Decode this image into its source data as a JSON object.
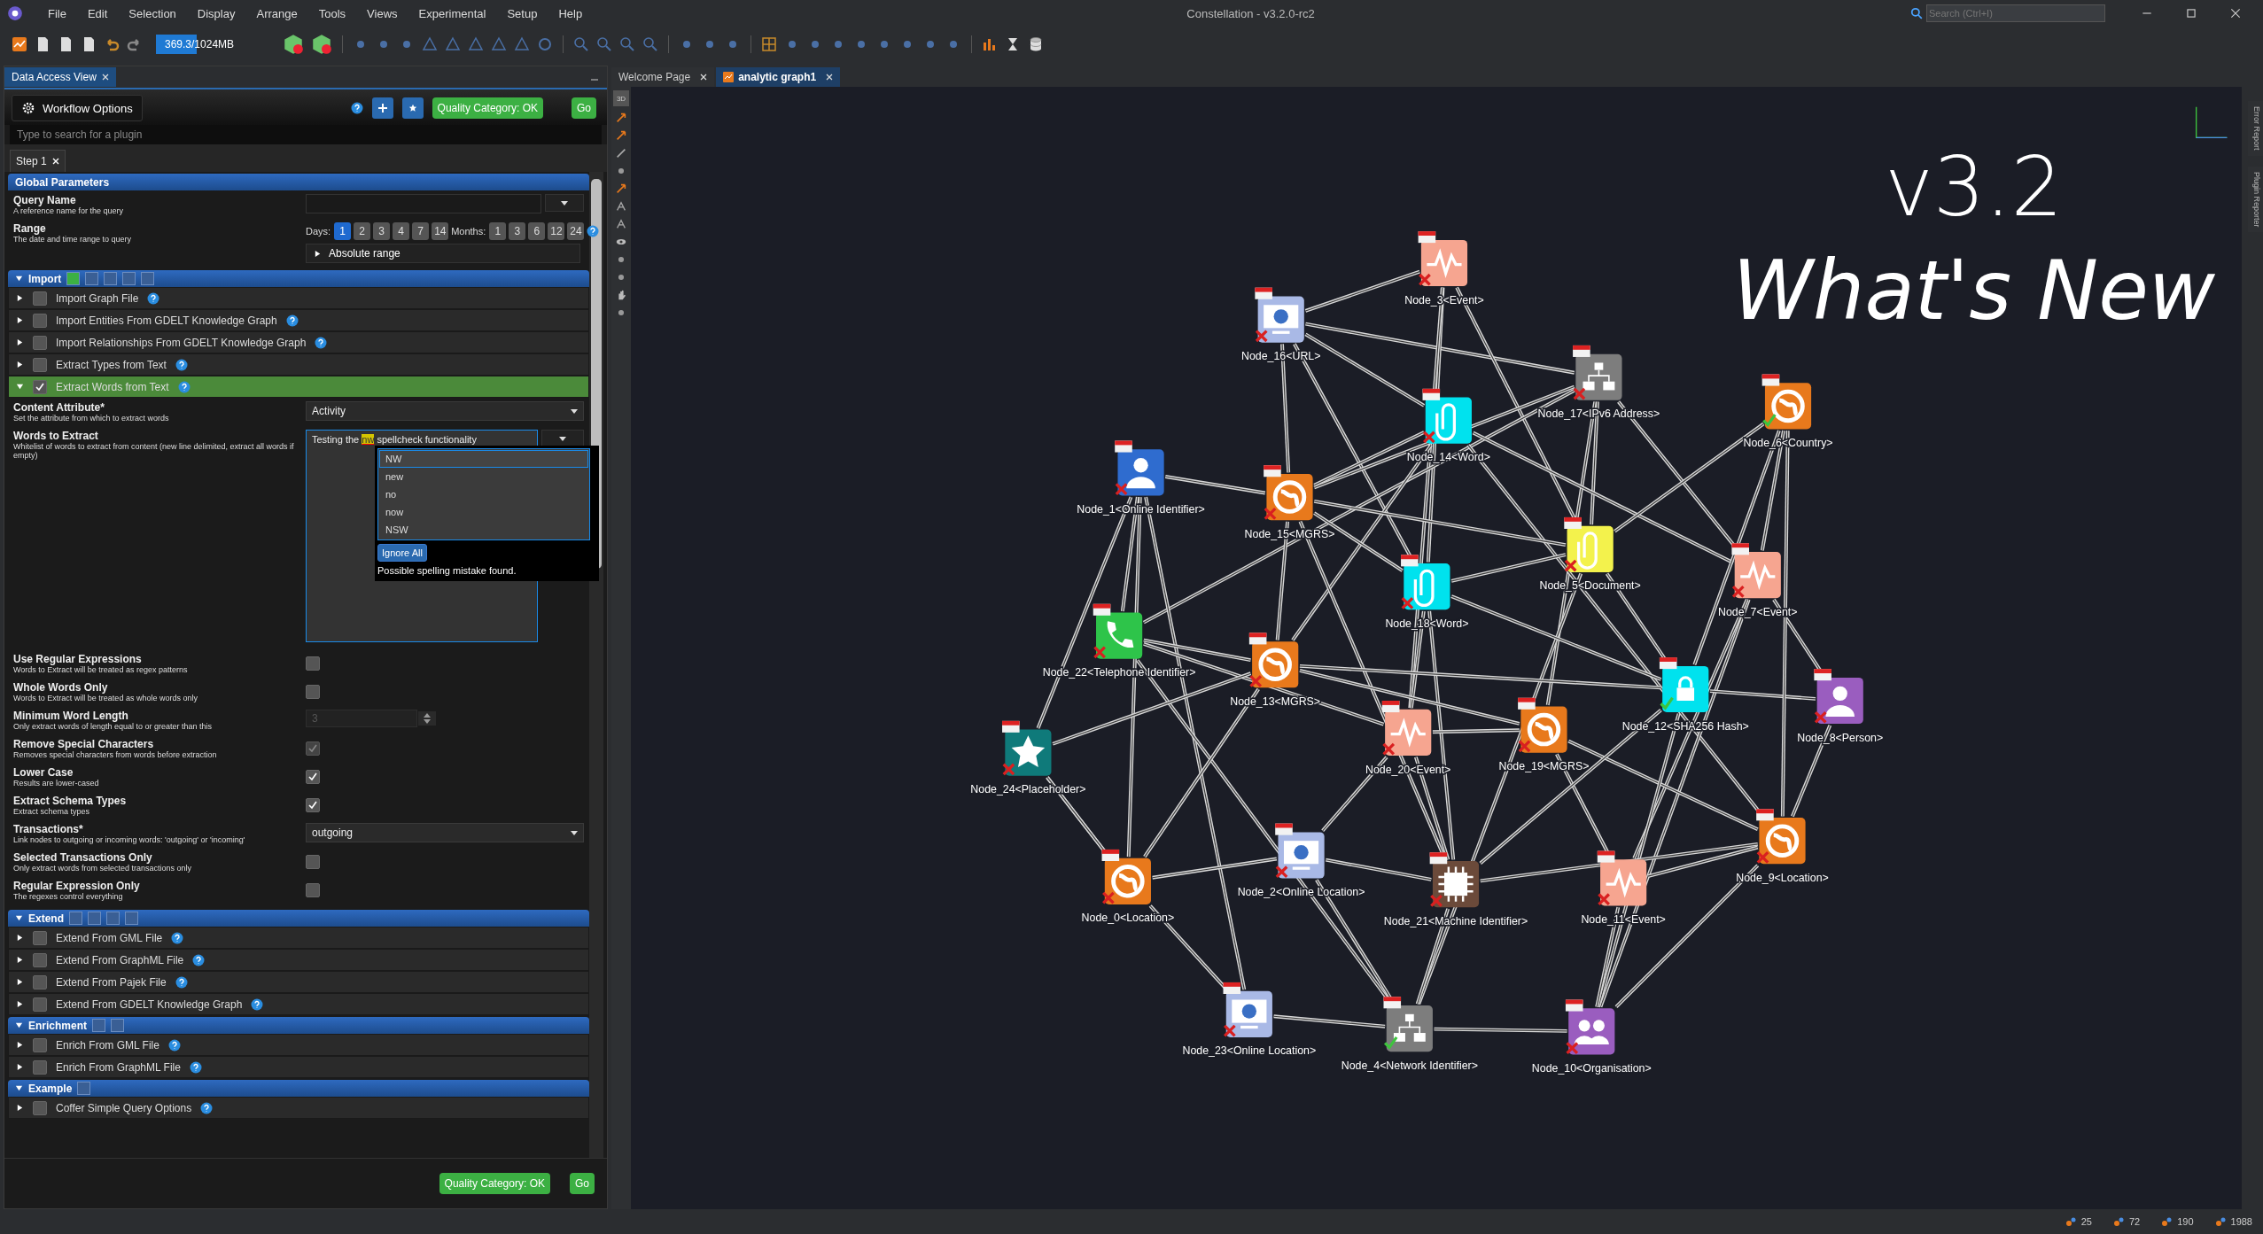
{
  "app": {
    "title": "Constellation - v3.2.0-rc2",
    "search_placeholder": "Search (Ctrl+I)"
  },
  "menu": [
    "File",
    "Edit",
    "Selection",
    "Display",
    "Arrange",
    "Tools",
    "Views",
    "Experimental",
    "Setup",
    "Help"
  ],
  "memory": {
    "reading": "369.3/1024MB",
    "level": 0.36
  },
  "left_tabs": [
    {
      "label": "Data Access View",
      "selected": true
    }
  ],
  "workflow": {
    "options_label": "Workflow Options",
    "quality": "Quality Category: OK",
    "go": "Go",
    "search_placeholder": "Type to search for a plugin",
    "step": "Step 1"
  },
  "global": {
    "title": "Global Parameters",
    "query_name": {
      "label": "Query Name",
      "desc": "A reference name for the query"
    },
    "range": {
      "label": "Range",
      "desc": "The date and time range to query",
      "days_label": "Days:",
      "months_label": "Months:",
      "absolute": "Absolute range",
      "days": [
        {
          "label": "1",
          "selected": true
        },
        {
          "label": "2",
          "selected": false
        },
        {
          "label": "3",
          "selected": false
        },
        {
          "label": "4",
          "selected": false
        },
        {
          "label": "7",
          "selected": false
        },
        {
          "label": "14",
          "selected": false
        }
      ],
      "months": [
        {
          "label": "1",
          "selected": false
        },
        {
          "label": "3",
          "selected": false
        },
        {
          "label": "6",
          "selected": false
        },
        {
          "label": "12",
          "selected": false
        },
        {
          "label": "24",
          "selected": false
        }
      ]
    }
  },
  "categories": [
    {
      "title": "Import",
      "expanded": true,
      "markers": [
        {
          "color": "#3cb043"
        },
        {
          "color": "#3a5f95"
        },
        {
          "color": "#3a5f95"
        },
        {
          "color": "#3a5f95"
        },
        {
          "color": "#3a5f95"
        }
      ],
      "plugins": [
        {
          "name": "Import Graph File",
          "checked": false,
          "expanded": false
        },
        {
          "name": "Import Entities From GDELT Knowledge Graph",
          "checked": false,
          "expanded": false
        },
        {
          "name": "Import Relationships From GDELT Knowledge Graph",
          "checked": false,
          "expanded": false
        },
        {
          "name": "Extract Types from Text",
          "checked": false,
          "expanded": false
        },
        {
          "name": "Extract Words from Text",
          "checked": true,
          "expanded": true,
          "params": [
            {
              "kind": "select",
              "label": "Content Attribute*",
              "desc": "Set the attribute from which to extract words",
              "value": "Activity"
            },
            {
              "kind": "textarea",
              "label": "Words to Extract",
              "desc": "Whitelist of words to extract from content (new line delimited, extract all words if empty)",
              "value_parts": [
                {
                  "text": "Testing the ",
                  "error": false
                },
                {
                  "text": "nw",
                  "error": true
                },
                {
                  "text": " spellcheck functionality",
                  "error": false
                }
              ],
              "spell": {
                "suggestions": [
                  {
                    "label": "NW",
                    "selected": true
                  },
                  {
                    "label": "new",
                    "selected": false
                  },
                  {
                    "label": "no",
                    "selected": false
                  },
                  {
                    "label": "now",
                    "selected": false
                  },
                  {
                    "label": "NSW",
                    "selected": false
                  }
                ],
                "ignore": "Ignore All",
                "message": "Possible spelling mistake found."
              }
            },
            {
              "kind": "checkbox",
              "label": "Use Regular Expressions",
              "desc": "Words to Extract will be treated as regex patterns",
              "checked": false,
              "disabled": false
            },
            {
              "kind": "checkbox",
              "label": "Whole Words Only",
              "desc": "Words to Extract will be treated as whole words only",
              "checked": false,
              "disabled": false
            },
            {
              "kind": "number",
              "label": "Minimum Word Length",
              "desc": "Only extract words of length equal to or greater than this",
              "value": "3",
              "disabled": true
            },
            {
              "kind": "checkbox",
              "label": "Remove Special Characters",
              "desc": "Removes special characters from words before extraction",
              "checked": true,
              "disabled": true
            },
            {
              "kind": "checkbox",
              "label": "Lower Case",
              "desc": "Results are lower-cased",
              "checked": true,
              "disabled": false
            },
            {
              "kind": "checkbox",
              "label": "Extract Schema Types",
              "desc": "Extract schema types",
              "checked": true,
              "disabled": false
            },
            {
              "kind": "select",
              "label": "Transactions*",
              "desc": "Link nodes to outgoing or incoming words: 'outgoing' or 'incoming'",
              "value": "outgoing"
            },
            {
              "kind": "checkbox",
              "label": "Selected Transactions Only",
              "desc": "Only extract words from selected transactions only",
              "checked": false,
              "disabled": false
            },
            {
              "kind": "checkbox",
              "label": "Regular Expression Only",
              "desc": "The regexes control everything",
              "checked": false,
              "disabled": false
            }
          ]
        }
      ]
    },
    {
      "title": "Extend",
      "expanded": true,
      "markers": [
        {
          "color": "#3a5f95"
        },
        {
          "color": "#3a5f95"
        },
        {
          "color": "#3a5f95"
        },
        {
          "color": "#3a5f95"
        }
      ],
      "plugins": [
        {
          "name": "Extend From GML File",
          "checked": false,
          "expanded": false
        },
        {
          "name": "Extend From GraphML File",
          "checked": false,
          "expanded": false
        },
        {
          "name": "Extend From Pajek File",
          "checked": false,
          "expanded": false
        },
        {
          "name": "Extend From GDELT Knowledge Graph",
          "checked": false,
          "expanded": false
        }
      ]
    },
    {
      "title": "Enrichment",
      "expanded": true,
      "markers": [
        {
          "color": "#3a5f95"
        },
        {
          "color": "#3a5f95"
        }
      ],
      "plugins": [
        {
          "name": "Enrich From GML File",
          "checked": false,
          "expanded": false
        },
        {
          "name": "Enrich From GraphML File",
          "checked": false,
          "expanded": false
        }
      ]
    },
    {
      "title": "Example",
      "expanded": true,
      "markers": [
        {
          "color": "#3a5f95"
        }
      ],
      "plugins": [
        {
          "name": "Coffer Simple Query Options",
          "checked": false,
          "expanded": false
        }
      ]
    }
  ],
  "footer": {
    "quality": "Quality Category: OK",
    "go": "Go"
  },
  "graph_tabs": [
    {
      "label": "Welcome Page",
      "selected": false
    },
    {
      "label": "analytic graph1",
      "selected": true
    }
  ],
  "canvas_tool": "3D",
  "side_tabs": [
    "Error Report",
    "Plugin Reporter"
  ],
  "overlay": {
    "version": "v3.2",
    "headline": "What's New"
  },
  "nodes": [
    {
      "label": "Node_3<Event>",
      "kind": "event",
      "color": "#f6a590",
      "check": false
    },
    {
      "label": "Node_16<URL>",
      "kind": "monitor",
      "color": "#a9b9e6",
      "check": false
    },
    {
      "label": "Node_17<IPv6 Address>",
      "kind": "network",
      "color": "#7d7d7d",
      "check": false
    },
    {
      "label": "Node_6<Country>",
      "kind": "globe",
      "color": "#e8791c",
      "check": true
    },
    {
      "label": "Node_14<Word>",
      "kind": "clip",
      "color": "#00e2ee",
      "check": false
    },
    {
      "label": "Node_1<Online Identifier>",
      "kind": "person",
      "color": "#2f6ccf",
      "check": false
    },
    {
      "label": "Node_15<MGRS>",
      "kind": "globe",
      "color": "#e8791c",
      "check": false
    },
    {
      "label": "Node_5<Document>",
      "kind": "clip",
      "color": "#f3f24c",
      "check": false
    },
    {
      "label": "Node_7<Event>",
      "kind": "event",
      "color": "#f6a590",
      "check": false
    },
    {
      "label": "Node_18<Word>",
      "kind": "clip",
      "color": "#00e2ee",
      "check": false
    },
    {
      "label": "Node_22<Telephone Identifier>",
      "kind": "phone",
      "color": "#2ec44a",
      "check": false
    },
    {
      "label": "Node_13<MGRS>",
      "kind": "globe",
      "color": "#e8791c",
      "check": false
    },
    {
      "label": "Node_12<SHA256 Hash>",
      "kind": "lock",
      "color": "#00e2ee",
      "check": true
    },
    {
      "label": "Node_8<Person>",
      "kind": "person",
      "color": "#9a5dbf",
      "check": false
    },
    {
      "label": "Node_24<Placeholder>",
      "kind": "star",
      "color": "#0f7a7a",
      "check": false
    },
    {
      "label": "Node_20<Event>",
      "kind": "event",
      "color": "#f6a590",
      "check": false
    },
    {
      "label": "Node_19<MGRS>",
      "kind": "globe",
      "color": "#e8791c",
      "check": false
    },
    {
      "label": "Node_2<Online Location>",
      "kind": "monitor",
      "color": "#a9b9e6",
      "check": false
    },
    {
      "label": "Node_21<Machine Identifier>",
      "kind": "chip",
      "color": "#6b4a3a",
      "check": false
    },
    {
      "label": "Node_11<Event>",
      "kind": "event",
      "color": "#f6a590",
      "check": false
    },
    {
      "label": "Node_9<Location>",
      "kind": "globe",
      "color": "#e8791c",
      "check": false
    },
    {
      "label": "Node_0<Location>",
      "kind": "globe",
      "color": "#e8791c",
      "check": false
    },
    {
      "label": "Node_23<Online Location>",
      "kind": "monitor",
      "color": "#a9b9e6",
      "check": false
    },
    {
      "label": "Node_4<Network Identifier>",
      "kind": "network",
      "color": "#7d7d7d",
      "check": true
    },
    {
      "label": "Node_10<Organisation>",
      "kind": "people",
      "color": "#9a5dbf",
      "check": false
    }
  ],
  "status": [
    "25",
    "72",
    "190",
    "1988"
  ]
}
